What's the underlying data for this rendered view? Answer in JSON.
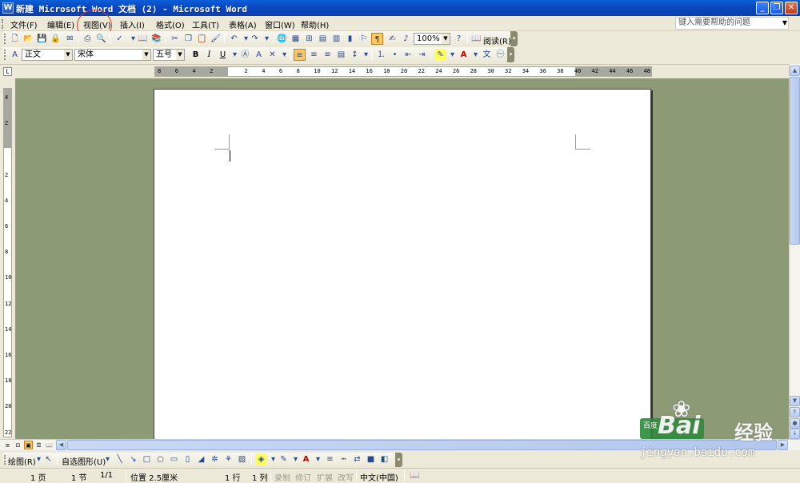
{
  "window": {
    "title": "新建 Microsoft Word 文档 (2) - Microsoft Word",
    "app_icon": "W",
    "controls": {
      "minimize": "_",
      "restore": "❐",
      "close": "✕"
    }
  },
  "menu": {
    "items": [
      "文件(F)",
      "编辑(E)",
      "视图(V)",
      "插入(I)",
      "格式(O)",
      "工具(T)",
      "表格(A)",
      "窗口(W)",
      "帮助(H)"
    ],
    "help_placeholder": "键入需要帮助的问题"
  },
  "standard_toolbar": {
    "zoom": "100%",
    "read_label": "阅读(R)"
  },
  "formatting_toolbar": {
    "style": "正文",
    "font": "宋体",
    "size": "五号",
    "bold": "B",
    "italic": "I",
    "underline": "U",
    "style_icon": "A"
  },
  "ruler": {
    "h_labels": [
      "8",
      "6",
      "4",
      "2",
      "",
      "2",
      "4",
      "6",
      "8",
      "10",
      "12",
      "14",
      "16",
      "18",
      "20",
      "22",
      "24",
      "26",
      "28",
      "30",
      "32",
      "34",
      "36",
      "38",
      "40",
      "42",
      "44",
      "46",
      "48"
    ],
    "v_labels": [
      "4",
      "2",
      "",
      "2",
      "4",
      "6",
      "8",
      "10",
      "12",
      "14",
      "16",
      "18",
      "20",
      "22"
    ],
    "tab_stop": "L"
  },
  "drawing_toolbar": {
    "draw_label": "绘图(R)",
    "autoshapes_label": "自选图形(U)"
  },
  "status": {
    "page": "1 页",
    "section": "1 节",
    "pages": "1/1",
    "position": "位置 2.5厘米",
    "line": "1 行",
    "column": "1 列",
    "rec": "录制",
    "trk": "修订",
    "ext": "扩展",
    "ovr": "改写",
    "language": "中文(中国)"
  },
  "watermark": {
    "brand": "Bai",
    "brand_cn": "经验",
    "url": "jingyan.baidu.com",
    "badge": "百度"
  },
  "colors": {
    "titlebar": "#0a4fcc",
    "workspace": "#8c9a76",
    "annotation_circle": "#d04030"
  }
}
